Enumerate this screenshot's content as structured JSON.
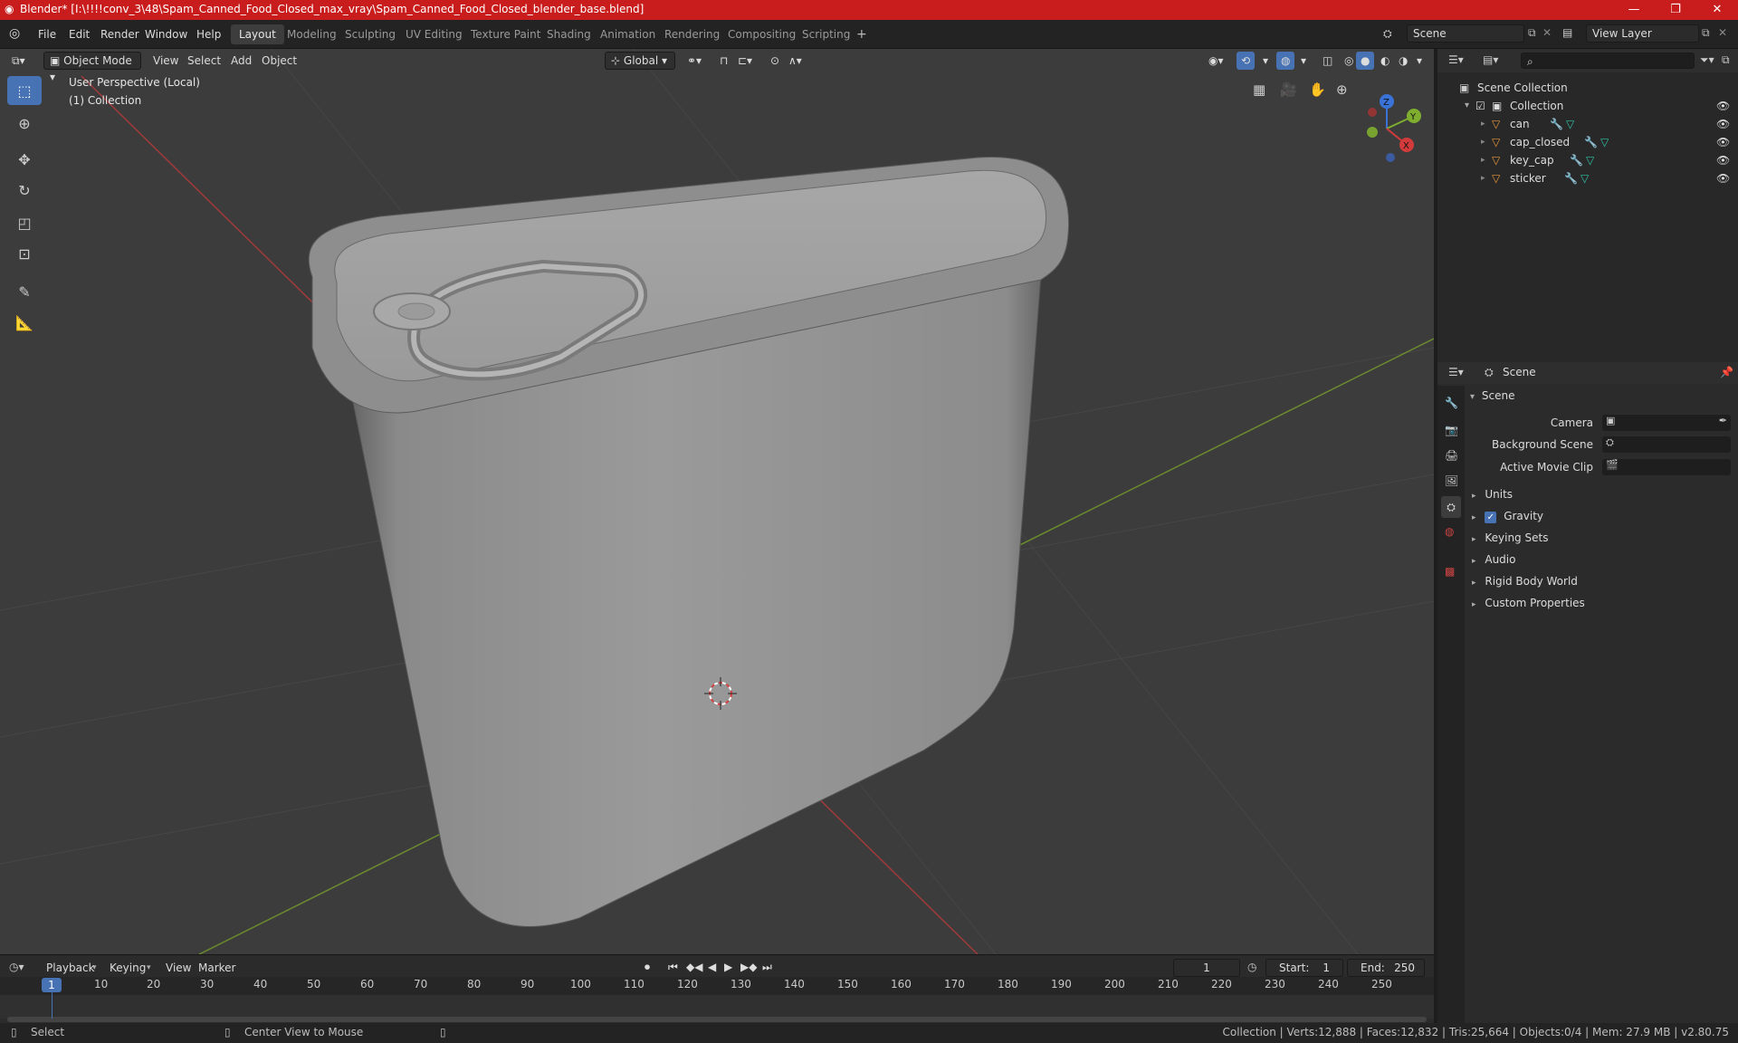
{
  "window": {
    "title": "Blender* [I:\\!!!!conv_3\\48\\Spam_Canned_Food_Closed_max_vray\\Spam_Canned_Food_Closed_blender_base.blend]"
  },
  "menu": [
    "File",
    "Edit",
    "Render",
    "Window",
    "Help"
  ],
  "workspaces": [
    "Layout",
    "Modeling",
    "Sculpting",
    "UV Editing",
    "Texture Paint",
    "Shading",
    "Animation",
    "Rendering",
    "Compositing",
    "Scripting"
  ],
  "active_workspace": "Layout",
  "scene_field": "Scene",
  "view_layer_field": "View Layer",
  "viewport": {
    "mode": "Object Mode",
    "header_menus": [
      "View",
      "Select",
      "Add",
      "Object"
    ],
    "orientation": "Global",
    "overlay_line1": "User Perspective (Local)",
    "overlay_line2": "(1) Collection",
    "gizmo_axes": [
      "X",
      "Y",
      "Z"
    ]
  },
  "outliner": {
    "root": "Scene Collection",
    "collection": "Collection",
    "objects": [
      "can",
      "cap_closed",
      "key_cap",
      "sticker"
    ]
  },
  "properties": {
    "context": "Scene",
    "panel_title": "Scene",
    "camera_label": "Camera",
    "background_scene_label": "Background Scene",
    "active_movie_clip_label": "Active Movie Clip",
    "sections": [
      "Units",
      "Gravity",
      "Keying Sets",
      "Audio",
      "Rigid Body World",
      "Custom Properties"
    ],
    "gravity_checked": true
  },
  "timeline": {
    "menus": [
      "Playback",
      "Keying",
      "View",
      "Marker"
    ],
    "current_frame": "1",
    "start_label": "Start:",
    "start": "1",
    "end_label": "End:",
    "end": "250",
    "ticks": [
      "1",
      "10",
      "20",
      "30",
      "40",
      "50",
      "60",
      "70",
      "80",
      "90",
      "100",
      "110",
      "120",
      "130",
      "140",
      "150",
      "160",
      "170",
      "180",
      "190",
      "200",
      "210",
      "220",
      "230",
      "240",
      "250"
    ]
  },
  "status": {
    "left_action": "Select",
    "middle_action": "Center View to Mouse",
    "stats": "Collection | Verts:12,888 | Faces:12,832 | Tris:25,664 | Objects:0/4 | Mem: 27.9 MB | v2.80.75"
  },
  "colors": {
    "titlebar": "#c91d1d",
    "accent": "#4772b3",
    "object_icon": "#e8963a",
    "mesh_icon": "#2fc3a7",
    "modifier_icon": "#6c9df0"
  }
}
